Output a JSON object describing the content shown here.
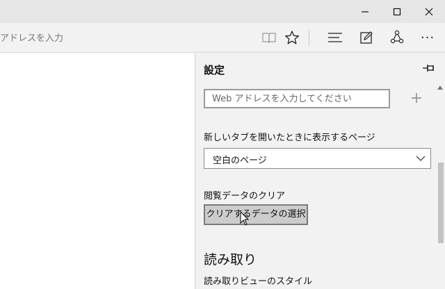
{
  "window": {
    "minimize_glyph": "—",
    "maximize_glyph": "☐",
    "close_glyph": "✕"
  },
  "toolbar": {
    "address_placeholder": "アドレスを入力",
    "icons": [
      "reading-view-icon",
      "favorite-star-icon",
      "hub-icon",
      "web-note-icon",
      "share-icon",
      "more-icon"
    ],
    "more_glyph": "···"
  },
  "settings": {
    "title": "設定",
    "web_input_placeholder": "Web アドレスを入力してください",
    "plus_glyph": "+",
    "new_tab_label": "新しいタブを開いたときに表示するページ",
    "new_tab_selected": "空白のページ",
    "clear_data_label": "閲覧データのクリア",
    "clear_button": "クリアするデータの選択",
    "reading_heading": "読み取り",
    "reading_style_label": "読み取りビューのスタイル"
  }
}
